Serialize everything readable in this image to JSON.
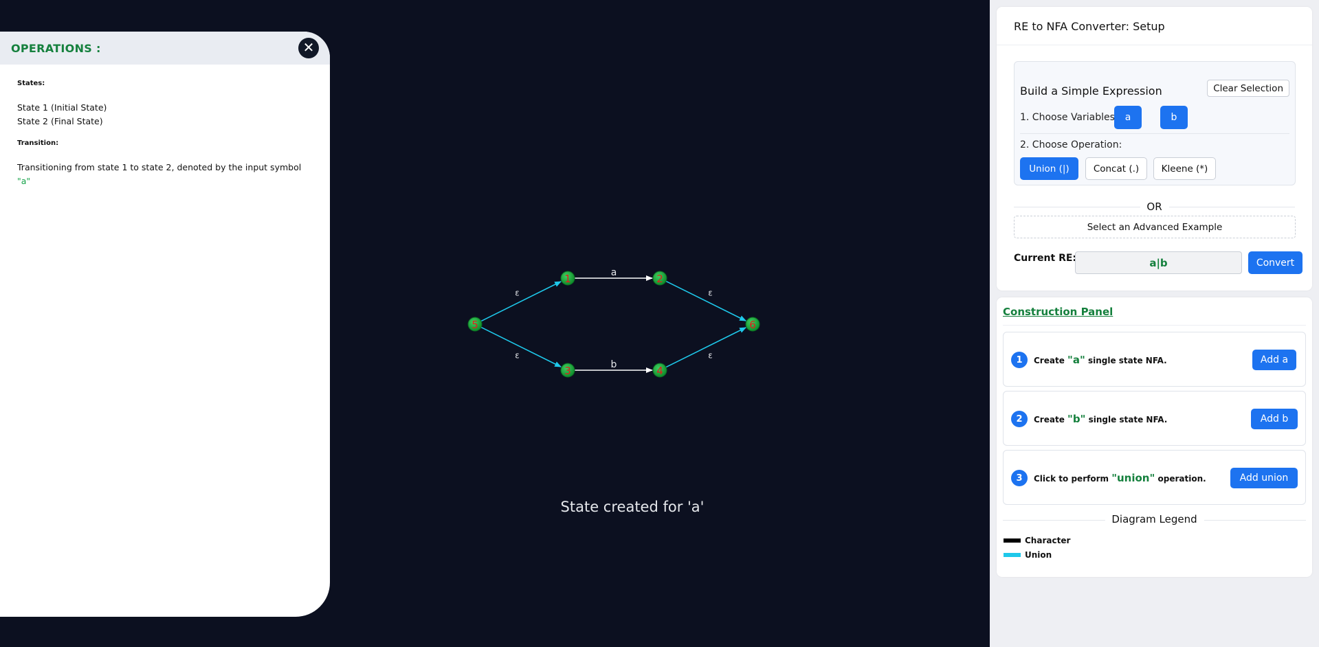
{
  "operations": {
    "title": "OPERATIONS :",
    "close_symbol": "✕",
    "states_heading": "States:",
    "state_lines": [
      "State 1 (Initial State)",
      "State 2 (Final State)"
    ],
    "transition_heading": "Transition:",
    "transition_prefix": "Transitioning from state 1 to state 2, denoted by the input symbol ",
    "transition_symbol": "\"a\""
  },
  "canvas": {
    "status_text": "State created for 'a'",
    "nodes": [
      "5",
      "1",
      "2",
      "3",
      "4",
      "6"
    ],
    "edges": [
      {
        "from": "5",
        "to": "1",
        "label": "ε",
        "kind": "union"
      },
      {
        "from": "1",
        "to": "2",
        "label": "a",
        "kind": "character"
      },
      {
        "from": "2",
        "to": "6",
        "label": "ε",
        "kind": "union"
      },
      {
        "from": "5",
        "to": "3",
        "label": "ε",
        "kind": "union"
      },
      {
        "from": "3",
        "to": "4",
        "label": "b",
        "kind": "character"
      },
      {
        "from": "4",
        "to": "6",
        "label": "ε",
        "kind": "union"
      }
    ],
    "colors": {
      "union": "#1ec8ea",
      "character": "#ffffff",
      "node": "#16a34a",
      "node_label": "#e11d1d"
    }
  },
  "setup": {
    "title": "RE to NFA Converter: Setup",
    "simple_title": "Build a Simple Expression",
    "clear_label": "Clear Selection",
    "variables_label": "1. Choose Variables:",
    "variables": [
      "a",
      "b"
    ],
    "operation_label": "2. Choose Operation:",
    "operations": [
      "Union (|)",
      "Concat (.)",
      "Kleene (*)"
    ],
    "selected_operation": "Union (|)",
    "or_text": "OR",
    "advanced_label": "Select an Advanced Example",
    "current_re_label": "Current RE:",
    "current_re_value": "a|b",
    "convert_label": "Convert"
  },
  "construction": {
    "title": "Construction Panel",
    "steps": [
      {
        "num": "1",
        "prefix": "Create ",
        "symbol": "\"a\"",
        "suffix": " single state NFA.",
        "button": "Add a"
      },
      {
        "num": "2",
        "prefix": "Create ",
        "symbol": "\"b\"",
        "suffix": " single state NFA.",
        "button": "Add b"
      },
      {
        "num": "3",
        "prefix": "Click to perform ",
        "symbol": "\"union\"",
        "suffix": " operation.",
        "button": "Add union"
      }
    ],
    "legend_title": "Diagram Legend",
    "legend": [
      {
        "label": "Character",
        "color": "#000000"
      },
      {
        "label": "Union",
        "color": "#1ec8ea"
      }
    ]
  }
}
